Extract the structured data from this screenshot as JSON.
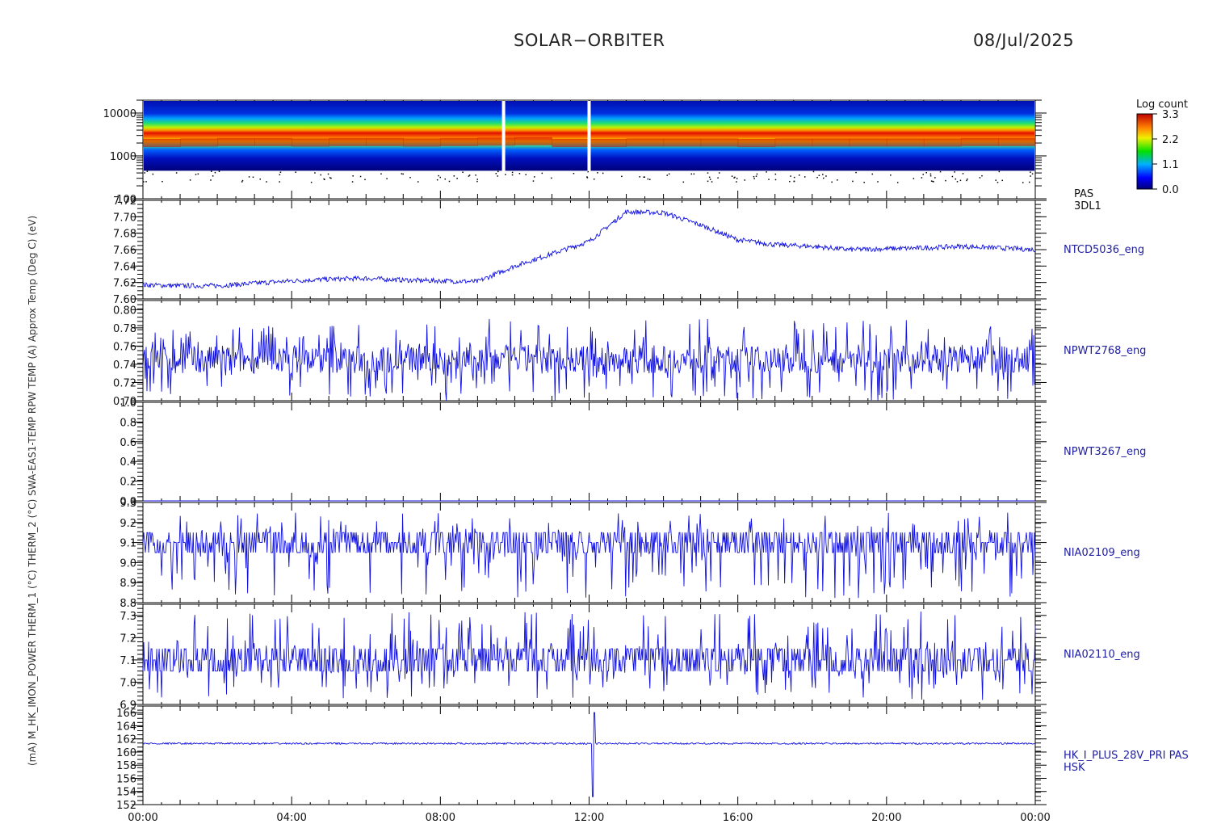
{
  "header": {
    "title": "SOLAR−ORBITER",
    "date": "08/Jul/2025"
  },
  "chart_data": [
    {
      "type": "heatmap",
      "panel": "pas-energy-spectrogram",
      "ylabel": "(eV)",
      "yscale": "log",
      "ylim": [
        100,
        20000
      ],
      "yticks": [
        "10000",
        "1000",
        "100"
      ],
      "right_label": [
        "PAS",
        "3DL1"
      ],
      "colorbar": {
        "title": "Log count",
        "ticks": [
          "3.3",
          "2.2",
          "1.1",
          "0.0"
        ],
        "range": [
          0.0,
          3.3
        ]
      },
      "peak_energy_ev_by_hour": [
        2000,
        2050,
        2100,
        2100,
        2050,
        2100,
        2100,
        2050,
        2100,
        2150,
        2200,
        2000,
        2000,
        2050,
        2050,
        2050,
        2000,
        2050,
        2050,
        2050,
        2050,
        2050,
        2100,
        2100,
        2100
      ],
      "data_gap_hours": [
        9.7,
        12.0
      ]
    },
    {
      "type": "line",
      "panel": "ntcd5036",
      "ylabel": "Approx Temp (Deg C)",
      "right_label": "NTCD5036_eng",
      "ylim": [
        7.6,
        7.72
      ],
      "yticks": [
        "7.72",
        "7.70",
        "7.68",
        "7.66",
        "7.64",
        "7.62",
        "7.60"
      ],
      "series": [
        {
          "hours": [
            0,
            1,
            2,
            3,
            4,
            5,
            6,
            7,
            8,
            9,
            10,
            11,
            12,
            13,
            14,
            15,
            16,
            17,
            18,
            19,
            20,
            21,
            22,
            23,
            24
          ],
          "values": [
            7.617,
            7.616,
            7.616,
            7.619,
            7.622,
            7.624,
            7.625,
            7.623,
            7.622,
            7.621,
            7.64,
            7.655,
            7.67,
            7.706,
            7.705,
            7.69,
            7.672,
            7.666,
            7.664,
            7.66,
            7.661,
            7.662,
            7.664,
            7.662,
            7.66
          ]
        }
      ]
    },
    {
      "type": "line",
      "panel": "npwt2768",
      "ylabel": "RPW TEMP (A)",
      "right_label": "NPWT2768_eng",
      "ylim": [
        0.7,
        0.81
      ],
      "yticks": [
        "0.80",
        "0.78",
        "0.76",
        "0.74",
        "0.72",
        "0.70"
      ],
      "series": [
        {
          "mean": 0.745,
          "noise_range": [
            0.71,
            0.8
          ]
        }
      ]
    },
    {
      "type": "line",
      "panel": "npwt3267",
      "ylabel": "SWA-EAS1-TEMP",
      "right_label": "NPWT3267_eng",
      "ylim": [
        0.0,
        1.0
      ],
      "yticks": [
        "1.0",
        "0.8",
        "0.6",
        "0.4",
        "0.2",
        "0.0"
      ],
      "series": [
        {
          "constant": 0.0
        }
      ]
    },
    {
      "type": "line",
      "panel": "nia02109",
      "ylabel": "THERM_2 (°C)",
      "right_label": "NIA02109_eng",
      "ylim": [
        8.8,
        9.3
      ],
      "yticks": [
        "9.3",
        "9.2",
        "9.1",
        "9.0",
        "8.9",
        "8.8"
      ],
      "series": [
        {
          "levels": [
            9.05,
            9.1,
            9.15
          ],
          "noise_range": [
            8.82,
            9.25
          ]
        }
      ]
    },
    {
      "type": "line",
      "panel": "nia02110",
      "ylabel": "THERM_1 (°C)",
      "right_label": "NIA02110_eng",
      "ylim": [
        6.9,
        7.35
      ],
      "yticks": [
        "7.3",
        "7.2",
        "7.1",
        "7.0",
        "6.9"
      ],
      "series": [
        {
          "levels": [
            7.05,
            7.1,
            7.15
          ],
          "noise_range": [
            6.92,
            7.32
          ]
        }
      ]
    },
    {
      "type": "line",
      "panel": "hk-i-plus-28v",
      "ylabel": "PAS_HK_IMON_POWER (mA)",
      "right_label": [
        "HK_I_PLUS_28V_PRI PAS",
        "HSK"
      ],
      "ylim": [
        152,
        167
      ],
      "yticks": [
        "166",
        "164",
        "162",
        "160",
        "158",
        "156",
        "154",
        "152"
      ],
      "series": [
        {
          "baseline": 161.3,
          "spike_hour": 12.1,
          "spike_min": 153.2,
          "spike_max": 166.0
        }
      ]
    }
  ],
  "x_axis": {
    "range_hours": [
      0,
      24
    ],
    "ticks": [
      "00:00",
      "04:00",
      "08:00",
      "12:00",
      "16:00",
      "20:00",
      "00:00"
    ]
  },
  "left_axis_text": "(mA) M_HK_IMON_POWER THERM_1 (°C) THERM_2 (°C) SWA-EAS1-TEMP RPW TEMP (A) Approx Temp (Deg C) (eV)",
  "colors": {
    "line": "#1010e0",
    "frame": "#000000"
  }
}
